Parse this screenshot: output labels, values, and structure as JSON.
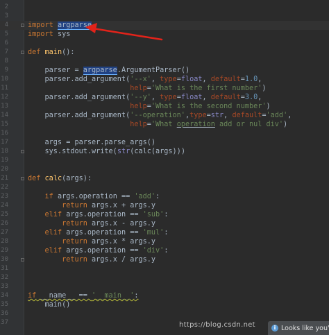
{
  "editor": {
    "lines": [
      {
        "num": "2"
      },
      {
        "num": "3"
      },
      {
        "num": "4",
        "t": [
          [
            "import",
            "kw"
          ],
          [
            " ",
            ""
          ],
          [
            "argparse",
            "hl"
          ]
        ]
      },
      {
        "num": "5",
        "t": [
          [
            "import",
            "kw"
          ],
          [
            " sys",
            ""
          ]
        ]
      },
      {
        "num": "6"
      },
      {
        "num": "7",
        "t": [
          [
            "def",
            "kw"
          ],
          [
            " ",
            ""
          ],
          [
            "main",
            "fn"
          ],
          [
            "():",
            ""
          ]
        ]
      },
      {
        "num": "8"
      },
      {
        "num": "9",
        "t": [
          [
            "    parser = ",
            ""
          ],
          [
            "argparse",
            "hl"
          ],
          [
            ".ArgumentParser()",
            ""
          ]
        ]
      },
      {
        "num": "10",
        "t": [
          [
            "    parser.add_argument(",
            ""
          ],
          [
            "'--x'",
            "str"
          ],
          [
            ", ",
            ""
          ],
          [
            "type",
            "kwarg"
          ],
          [
            "=",
            ""
          ],
          [
            "float",
            "builtin"
          ],
          [
            ", ",
            ""
          ],
          [
            "default",
            "kwarg"
          ],
          [
            "=",
            ""
          ],
          [
            "1.0",
            "num"
          ],
          [
            ",",
            ""
          ]
        ]
      },
      {
        "num": "11",
        "t": [
          [
            "                        ",
            ""
          ],
          [
            "help",
            "kwarg"
          ],
          [
            "=",
            ""
          ],
          [
            "'What is the first number'",
            "str"
          ],
          [
            ")",
            ""
          ]
        ]
      },
      {
        "num": "12",
        "t": [
          [
            "    parser.add_argument(",
            ""
          ],
          [
            "'--y'",
            "str"
          ],
          [
            ", ",
            ""
          ],
          [
            "type",
            "kwarg"
          ],
          [
            "=",
            ""
          ],
          [
            "float",
            "builtin"
          ],
          [
            ", ",
            ""
          ],
          [
            "default",
            "kwarg"
          ],
          [
            "=",
            ""
          ],
          [
            "3.0",
            "num"
          ],
          [
            ",",
            ""
          ]
        ]
      },
      {
        "num": "13",
        "t": [
          [
            "                        ",
            ""
          ],
          [
            "help",
            "kwarg"
          ],
          [
            "=",
            ""
          ],
          [
            "'What is the second number'",
            "str"
          ],
          [
            ")",
            ""
          ]
        ]
      },
      {
        "num": "14",
        "t": [
          [
            "    parser.add_argument(",
            ""
          ],
          [
            "'--operation'",
            "str"
          ],
          [
            ",",
            ""
          ],
          [
            "type",
            "kwarg"
          ],
          [
            "=",
            ""
          ],
          [
            "str",
            "builtin"
          ],
          [
            ", ",
            ""
          ],
          [
            "default",
            "kwarg"
          ],
          [
            "=",
            ""
          ],
          [
            "'add'",
            "str"
          ],
          [
            ",",
            ""
          ]
        ]
      },
      {
        "num": "15",
        "t": [
          [
            "                        ",
            ""
          ],
          [
            "help",
            "kwarg"
          ],
          [
            "=",
            ""
          ],
          [
            "'What ",
            "str"
          ],
          [
            "operation",
            "strund"
          ],
          [
            " add or nul div'",
            "str"
          ],
          [
            ")",
            ""
          ]
        ]
      },
      {
        "num": "16"
      },
      {
        "num": "17",
        "t": [
          [
            "    args = parser.parse_args()",
            ""
          ]
        ]
      },
      {
        "num": "18",
        "t": [
          [
            "    sys.stdout.write(",
            ""
          ],
          [
            "str",
            "builtin"
          ],
          [
            "(calc(args)))",
            ""
          ]
        ]
      },
      {
        "num": "19"
      },
      {
        "num": "20"
      },
      {
        "num": "21",
        "t": [
          [
            "def",
            "kw"
          ],
          [
            " ",
            ""
          ],
          [
            "calc",
            "fn"
          ],
          [
            "(args):",
            ""
          ]
        ]
      },
      {
        "num": "22"
      },
      {
        "num": "23",
        "t": [
          [
            "    ",
            ""
          ],
          [
            "if",
            "kw"
          ],
          [
            " args.operation == ",
            ""
          ],
          [
            "'add'",
            "str"
          ],
          [
            ":",
            ""
          ]
        ]
      },
      {
        "num": "24",
        "t": [
          [
            "        ",
            ""
          ],
          [
            "return",
            "kw"
          ],
          [
            " args.x + args.y",
            ""
          ]
        ]
      },
      {
        "num": "25",
        "t": [
          [
            "    ",
            ""
          ],
          [
            "elif",
            "kw"
          ],
          [
            " args.operation == ",
            ""
          ],
          [
            "'sub'",
            "str"
          ],
          [
            ":",
            ""
          ]
        ]
      },
      {
        "num": "26",
        "t": [
          [
            "        ",
            ""
          ],
          [
            "return",
            "kw"
          ],
          [
            " args.x - args.y",
            ""
          ]
        ]
      },
      {
        "num": "27",
        "t": [
          [
            "    ",
            ""
          ],
          [
            "elif",
            "kw"
          ],
          [
            " args.operation == ",
            ""
          ],
          [
            "'mul'",
            "str"
          ],
          [
            ":",
            ""
          ]
        ]
      },
      {
        "num": "28",
        "t": [
          [
            "        ",
            ""
          ],
          [
            "return",
            "kw"
          ],
          [
            " args.x * args.y",
            ""
          ]
        ]
      },
      {
        "num": "29",
        "t": [
          [
            "    ",
            ""
          ],
          [
            "elif",
            "kw"
          ],
          [
            " args.operation == ",
            ""
          ],
          [
            "'div'",
            "str"
          ],
          [
            ":",
            ""
          ]
        ]
      },
      {
        "num": "30",
        "t": [
          [
            "        ",
            ""
          ],
          [
            "return",
            "kw"
          ],
          [
            " args.x / args.y",
            ""
          ]
        ]
      },
      {
        "num": "31"
      },
      {
        "num": "32"
      },
      {
        "num": "33"
      },
      {
        "num": "34",
        "t": [
          [
            "if",
            "kwsq"
          ],
          [
            " __name__ == ",
            "sq"
          ],
          [
            "'__main__'",
            "strsq"
          ],
          [
            ":",
            "sq"
          ]
        ]
      },
      {
        "num": "35",
        "t": [
          [
            "    main()",
            ""
          ]
        ]
      },
      {
        "num": "36"
      },
      {
        "num": "37"
      }
    ]
  },
  "watermark": "https://blog.csdn.net",
  "notification": {
    "icon": "info-icon",
    "text": "Looks like you're"
  },
  "colors": {
    "background": "#2b2b2b",
    "gutter": "#313335",
    "keyword": "#cc7832",
    "string": "#6a8759",
    "number": "#6897bb",
    "kwarg": "#aa4926",
    "builtin": "#8888c6",
    "function": "#ffc66d",
    "arrow": "#e2231a"
  }
}
